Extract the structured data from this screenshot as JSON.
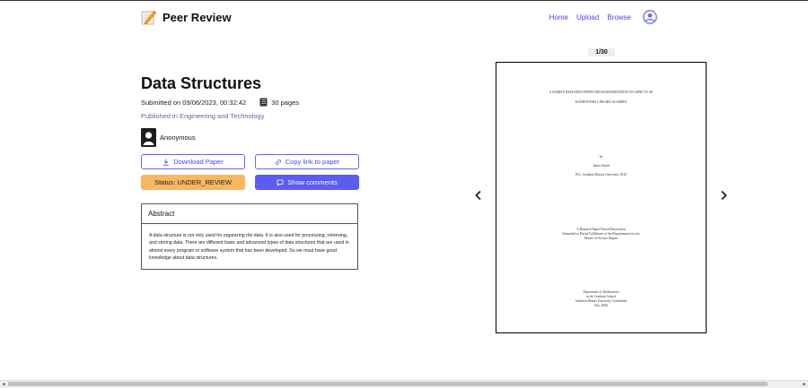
{
  "header": {
    "brand": "Peer Review",
    "nav": [
      "Home",
      "Upload",
      "Browse"
    ]
  },
  "paper": {
    "title": "Data Structures",
    "submitted": "Submitted on 09/06/2023, 00:32:42",
    "pages": "30 pages",
    "published": "Published in Engineering and Technology",
    "author": "Anonymous",
    "download_label": "Download Paper",
    "copy_label": "Copy link to paper",
    "status_label": "Status: UNDER_REVIEW",
    "comments_label": "Show comments",
    "abstract_heading": "Abstract",
    "abstract_text": "A data structure is not only used for organizing the data. It is also used for processing, retrieving, and storing data. There are different basic and advanced types of data structures that are used in almost every program or software system that has been developed. So we must have good knowledge about data structures."
  },
  "viewer": {
    "page_indicator": "1/30",
    "lines": [
      "A SAMPLE RESEARCH PAPER/THESIS/DISSERTATION ON ASPECTS OF",
      "ELEMENTARY LINEARY ALGEBRA",
      "by",
      "James Smith",
      "B.S., Southern Illinois University, 2010",
      "A Research Paper/Thesis/Dissertation",
      "Submitted in Partial Fulfillment of the Requirements for the",
      "Master of Science Degree",
      "Department of Mathematics",
      "in the Graduate School",
      "Southern Illinois University Carbondale",
      "July, 2006"
    ]
  },
  "icons": {
    "logo": "memo-pencil-icon",
    "avatar": "user-circle-icon",
    "pages": "book-icon",
    "download": "download-icon",
    "copy": "link-icon",
    "comments": "chat-icon",
    "prev": "chevron-left-icon",
    "next": "chevron-right-icon"
  }
}
